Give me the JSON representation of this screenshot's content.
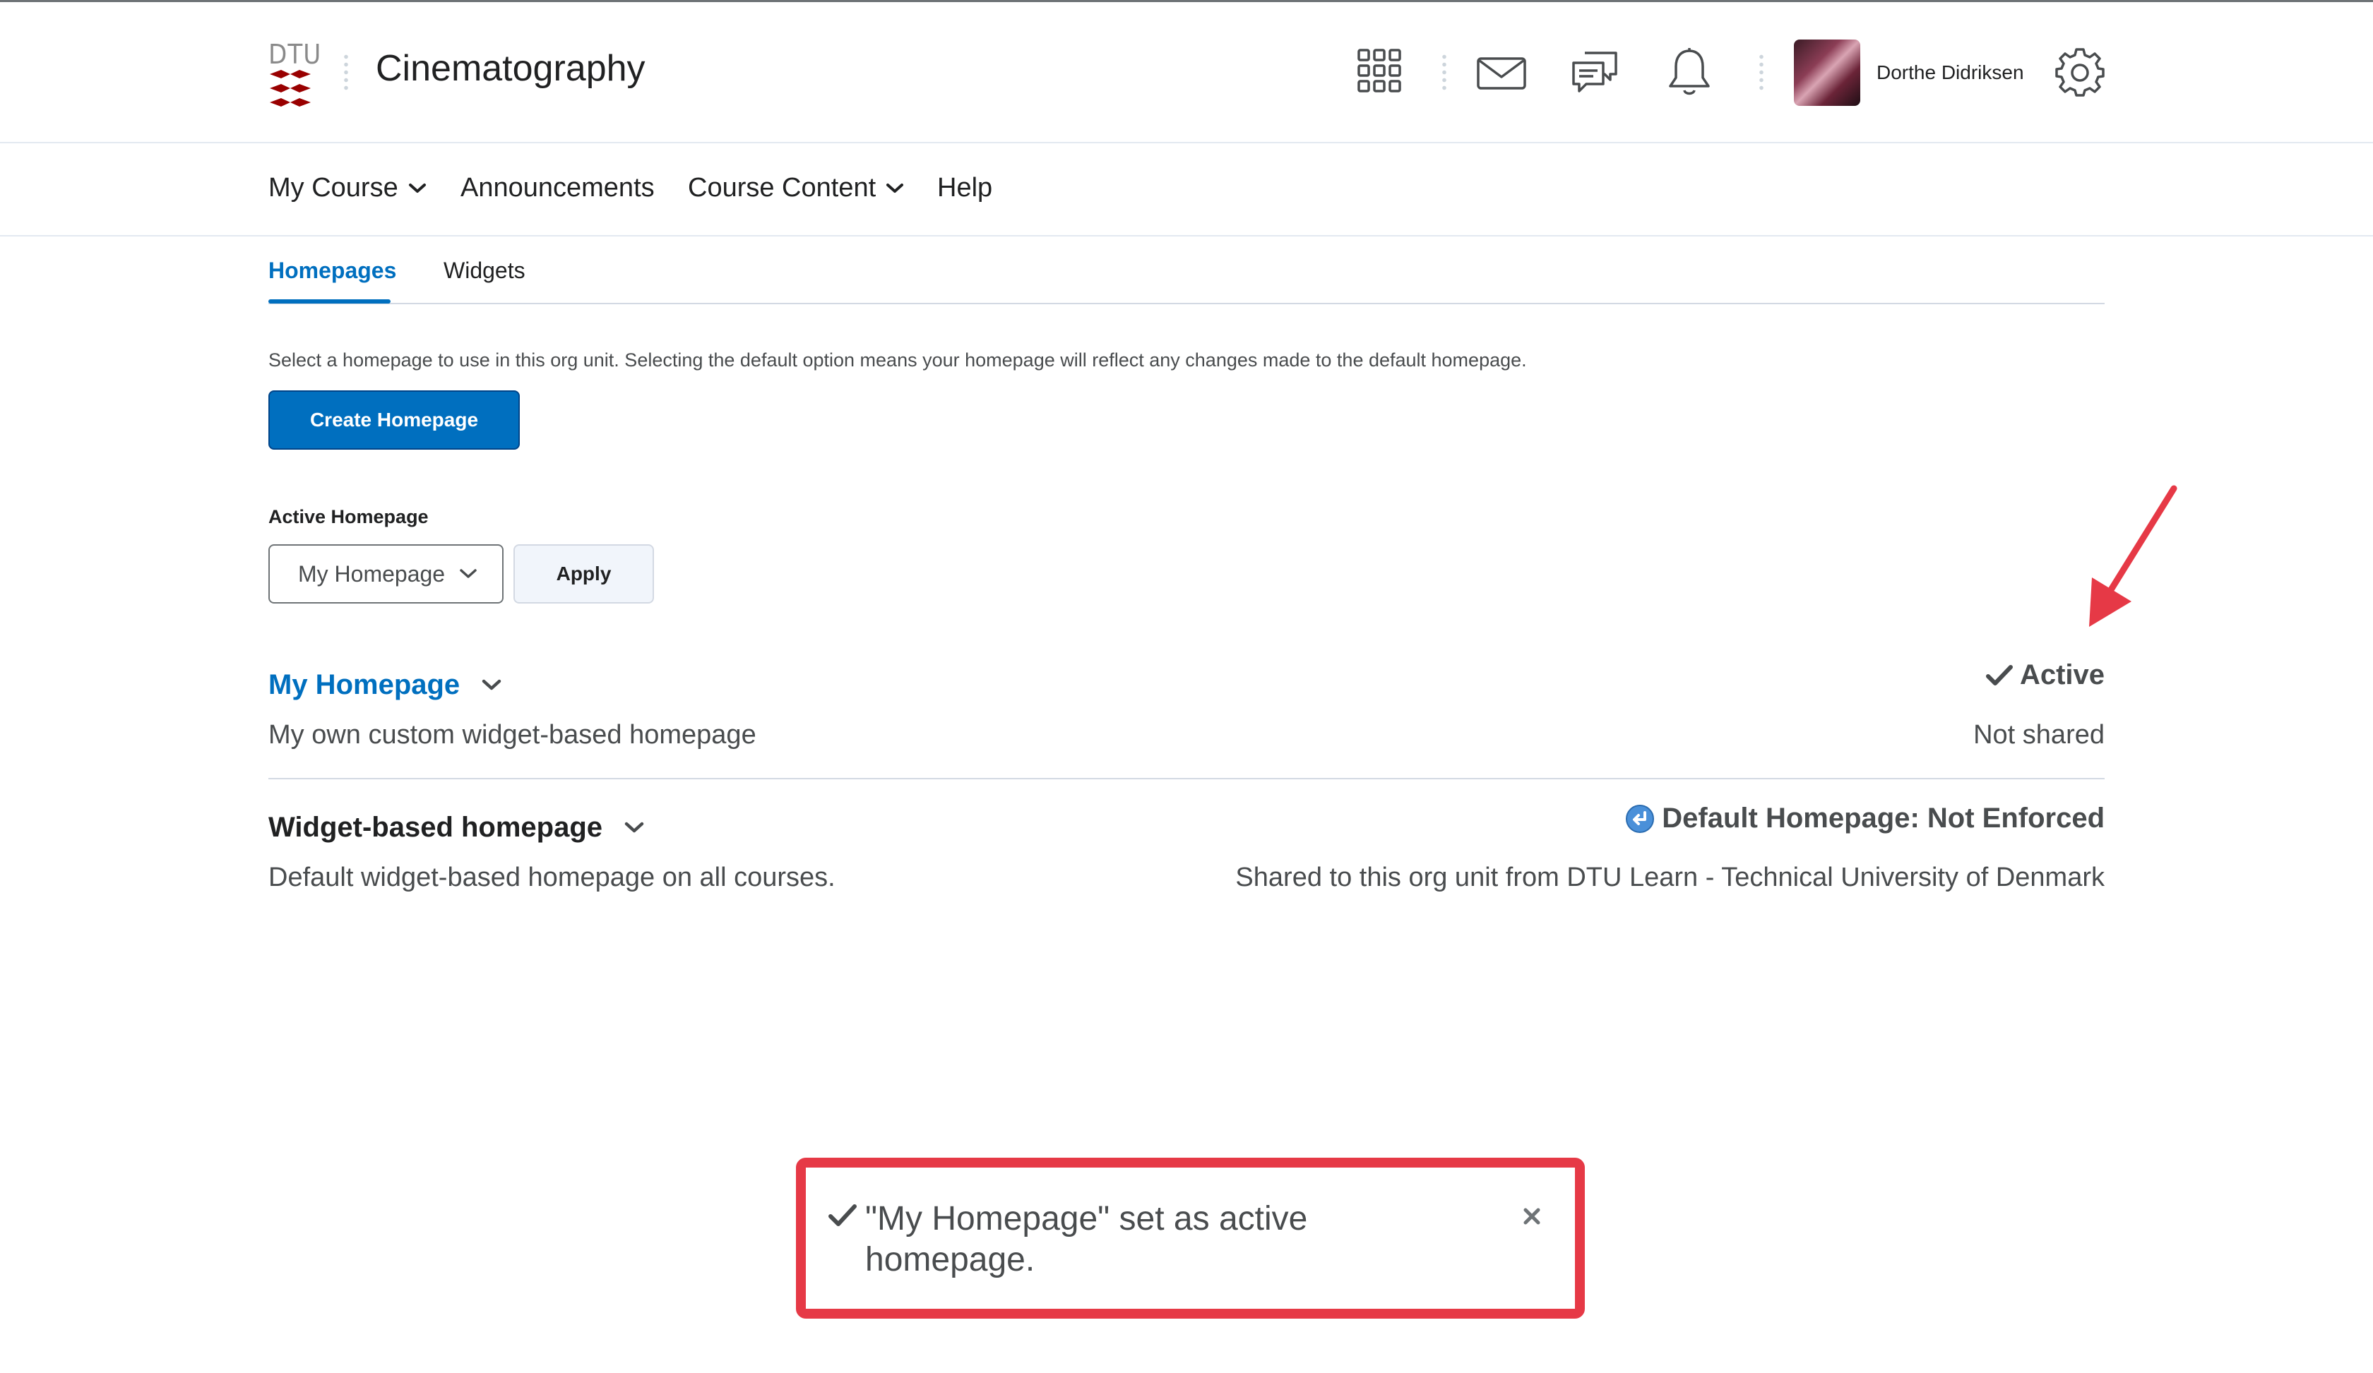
{
  "header": {
    "logo_text": "DTU",
    "course_title": "Cinematography",
    "user_name": "Dorthe Didriksen"
  },
  "nav": {
    "items": [
      {
        "label": "My Course",
        "has_dropdown": true
      },
      {
        "label": "Announcements",
        "has_dropdown": false
      },
      {
        "label": "Course Content",
        "has_dropdown": true
      },
      {
        "label": "Help",
        "has_dropdown": false
      }
    ]
  },
  "tabs": [
    {
      "label": "Homepages",
      "active": true
    },
    {
      "label": "Widgets",
      "active": false
    }
  ],
  "description": "Select a homepage to use in this org unit. Selecting the default option means your homepage will reflect any changes made to the default homepage.",
  "create_button": "Create Homepage",
  "active_homepage": {
    "label": "Active Homepage",
    "selected": "My Homepage",
    "apply_label": "Apply"
  },
  "homepages": [
    {
      "title": "My Homepage",
      "description": "My own custom widget-based homepage",
      "status": "Active",
      "sharing": "Not shared"
    },
    {
      "title": "Widget-based homepage",
      "description": "Default widget-based homepage on all courses.",
      "status": "Default Homepage: Not Enforced",
      "sharing": "Shared to this org unit from DTU Learn - Technical University of Denmark"
    }
  ],
  "toast": {
    "message": "\"My Homepage\" set as active homepage."
  },
  "colors": {
    "primary": "#006fbf",
    "text": "#494c4e",
    "annotation": "#e63946",
    "dtu_red": "#990000"
  }
}
